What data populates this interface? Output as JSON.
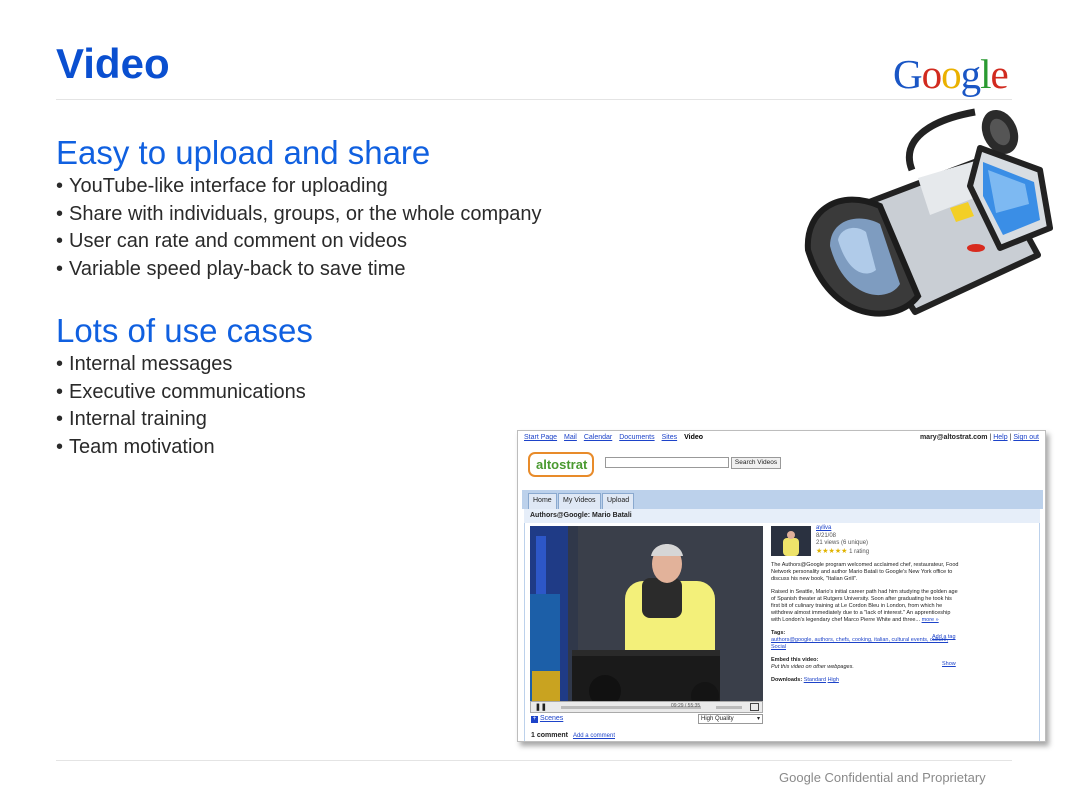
{
  "slide": {
    "title": "Video",
    "logo_text": "Google",
    "section1": {
      "heading": "Easy to upload and share",
      "bullets": [
        "YouTube-like interface for uploading",
        "Share with individuals, groups, or the whole company",
        "User can rate and comment on videos",
        "Variable speed play-back to save time"
      ]
    },
    "section2": {
      "heading": "Lots of use cases",
      "bullets": [
        "Internal messages",
        "Executive communications",
        "Internal  training",
        "Team motivation"
      ]
    },
    "footer": "Google Confidential and Proprietary"
  },
  "app": {
    "nav": [
      "Start Page",
      "Mail",
      "Calendar",
      "Documents",
      "Sites"
    ],
    "nav_current": "Video",
    "user_email": "mary@altostrat.com",
    "help": "Help",
    "signout": "Sign out",
    "logo": "altostrat",
    "search_value": "",
    "search_button": "Search Videos",
    "tabs": [
      "Home",
      "My Videos",
      "Upload"
    ],
    "video_title": "Authors@Google: Mario Batali",
    "time_readout": "09:29 / 55:35",
    "scenes": "Scenes",
    "quality": "High Quality",
    "comments_count": "1 comment",
    "add_comment": "Add a comment",
    "uploader": "ayliva",
    "date": "8/21/08",
    "views": "21 views (6 unique)",
    "rating_stars": "★★★★★",
    "rating": "1 rating",
    "desc1": "The Authors@Google program welcomed acclaimed chef, restaurateur, Food Network personality and author Mario Batali to Google's New York office to discuss his new book, \"Italian Grill\".",
    "desc2": "Raised in Seattle, Mario's initial career path had him studying the golden age of Spanish theater at Rutgers University. Soon after graduating he took his first bit of culinary training at Le Cordon Bleu in London, from which he withdrew almost immediately due to a \"lack of interest.\" An apprenticeship with London's legendary chef Marco Pierre White and three...",
    "more": "more »",
    "tags_label": "Tags:",
    "add_tag": "Add a tag",
    "tags": "authors@google, authors, chefs, cooking, italian, cultural events, culture, Social",
    "embed_label": "Embed this video:",
    "embed_show": "Show",
    "embed_desc": "Put this video on other webpages.",
    "downloads_label": "Downloads:",
    "dl_standard": "Standard",
    "dl_high": "High"
  },
  "colors": {
    "title": "#0a4fd0",
    "heading": "#1060e0",
    "tabbar": "#bcd1eb",
    "link": "#1d43c9"
  },
  "icons": [
    "video-camera-icon",
    "play-pause-icon",
    "fullscreen-icon",
    "plus-icon"
  ]
}
